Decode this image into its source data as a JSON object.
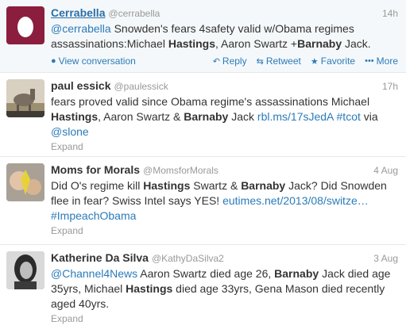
{
  "tweets": [
    {
      "name": "Cerrabella",
      "handle": "@cerrabella",
      "time": "14h",
      "segments": [
        {
          "t": "@cerrabella",
          "k": "link"
        },
        {
          "t": " Snowden's fears 4safety valid w/Obama regimes assassinations:Michael "
        },
        {
          "t": "Hastings",
          "k": "bold"
        },
        {
          "t": ", Aaron Swartz +"
        },
        {
          "t": "Barnaby",
          "k": "bold"
        },
        {
          "t": " Jack."
        }
      ],
      "actions": {
        "view_conversation": "View conversation",
        "reply": "Reply",
        "retweet": "Retweet",
        "favorite": "Favorite",
        "more": "More"
      }
    },
    {
      "name": "paul essick",
      "handle": "@paulessick",
      "time": "17h",
      "segments": [
        {
          "t": "fears proved valid since Obama regime's assassinations Michael "
        },
        {
          "t": "Hastings",
          "k": "bold"
        },
        {
          "t": ", Aaron Swartz & "
        },
        {
          "t": "Barnaby",
          "k": "bold"
        },
        {
          "t": " Jack "
        },
        {
          "t": "rbl.ms/17sJedA",
          "k": "link"
        },
        {
          "t": " "
        },
        {
          "t": "#tcot",
          "k": "link"
        },
        {
          "t": " via "
        },
        {
          "t": "@slone",
          "k": "link"
        }
      ],
      "expand": "Expand"
    },
    {
      "name": "Moms for Morals",
      "handle": "@MomsforMorals",
      "time": "4 Aug",
      "segments": [
        {
          "t": "Did O's regime kill "
        },
        {
          "t": "Hastings",
          "k": "bold"
        },
        {
          "t": " Swartz & "
        },
        {
          "t": "Barnaby",
          "k": "bold"
        },
        {
          "t": " Jack? Did Snowden flee in fear? Swiss Intel says YES! "
        },
        {
          "t": "eutimes.net/2013/08/switze…",
          "k": "link"
        },
        {
          "t": " "
        },
        {
          "t": "#ImpeachObama",
          "k": "link"
        }
      ],
      "expand": "Expand"
    },
    {
      "name": "Katherine Da Silva",
      "handle": "@KathyDaSilva2",
      "time": "3 Aug",
      "segments": [
        {
          "t": "@Channel4News",
          "k": "link"
        },
        {
          "t": " Aaron Swartz died age 26, "
        },
        {
          "t": "Barnaby",
          "k": "bold"
        },
        {
          "t": " Jack died age 35yrs, Michael "
        },
        {
          "t": "Hastings",
          "k": "bold"
        },
        {
          "t": " died age 33yrs, Gena Mason died recently aged 40yrs."
        }
      ],
      "expand": "Expand"
    }
  ],
  "colors": {
    "link": "#2b7bb9",
    "avatar_egg_bg": "#8b1e3f"
  },
  "icons": {
    "avatar_0": "egg-avatar",
    "avatar_1": "donkey-photo",
    "avatar_2": "ribbon-photo",
    "avatar_3": "portrait-photo",
    "view_conversation": "speech-bubble-icon",
    "reply": "reply-arrow-icon",
    "retweet": "retweet-icon",
    "favorite": "star-icon",
    "more": "dots-icon"
  }
}
